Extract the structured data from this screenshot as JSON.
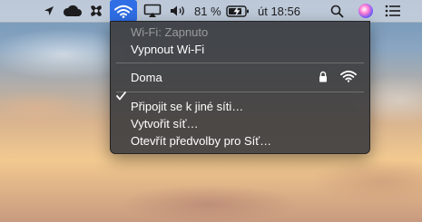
{
  "menubar": {
    "battery_percent": "81 %",
    "clock": "út 18:56"
  },
  "wifi_menu": {
    "status": "Wi-Fi: Zapnuto",
    "turn_off": "Vypnout Wi-Fi",
    "network": "Doma",
    "join_other": "Připojit se k jiné síti…",
    "create_network": "Vytvořit síť…",
    "open_prefs": "Otevřít předvolby pro Síť…"
  },
  "icons": [
    "location-arrow-icon",
    "cloud-icon",
    "wrench-icon",
    "wifi-icon",
    "airplay-icon",
    "volume-icon",
    "battery-charging-icon",
    "search-icon",
    "siri-icon",
    "notification-center-icon",
    "checkmark-icon",
    "lock-icon",
    "wifi-signal-icon"
  ],
  "colors": {
    "accent": "#2f6ee5",
    "menu_background": "#3c3c3e"
  }
}
